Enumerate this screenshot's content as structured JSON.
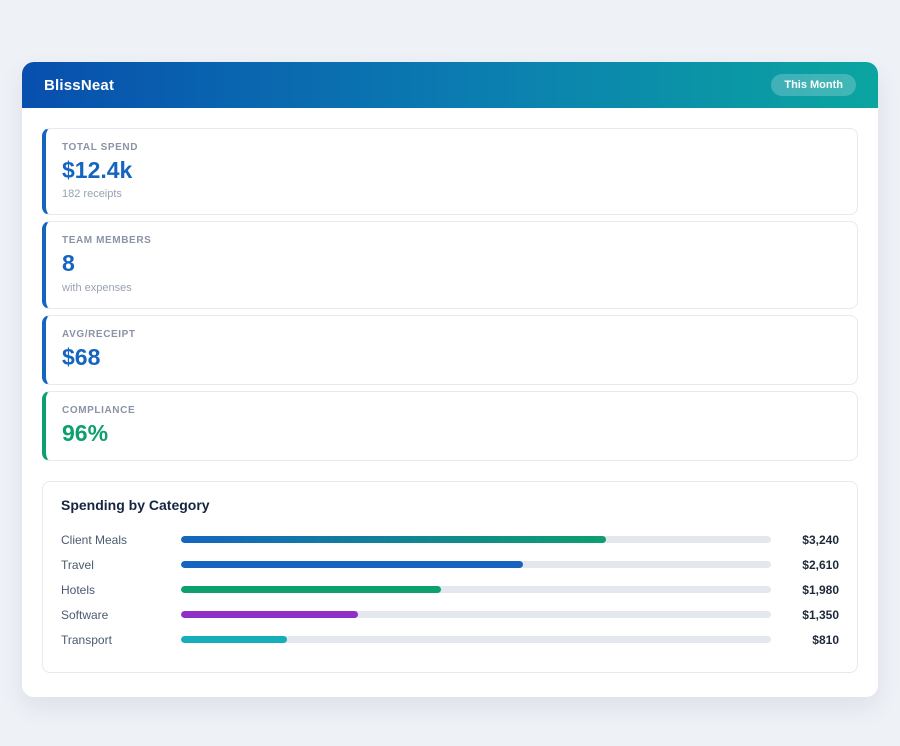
{
  "app": {
    "title": "BlissNeat",
    "period_badge": "This Month"
  },
  "colors": {
    "header_gradient_start": "#084fae",
    "header_gradient_end": "#0ba5a0",
    "primary_blue": "#1565c0",
    "success_green": "#0e9f6e"
  },
  "stats": [
    {
      "label": "TOTAL SPEND",
      "value": "$12.4k",
      "sub": "182 receipts",
      "accent": "#1565c0",
      "value_color": "#1565c0"
    },
    {
      "label": "TEAM MEMBERS",
      "value": "8",
      "sub": "with expenses",
      "accent": "#1565c0",
      "value_color": "#1565c0"
    },
    {
      "label": "AVG/RECEIPT",
      "value": "$68",
      "accent": "#1565c0",
      "value_color": "#1565c0"
    },
    {
      "label": "COMPLIANCE",
      "value": "96%",
      "accent": "#0e9f6e",
      "value_color": "#0e9f6e"
    }
  ],
  "chart_data": {
    "type": "bar",
    "title": "Spending by Category",
    "categories": [
      "Client Meals",
      "Travel",
      "Hotels",
      "Software",
      "Transport"
    ],
    "values": [
      3240,
      2610,
      1980,
      1350,
      810
    ],
    "value_labels": [
      "$3,240",
      "$2,610",
      "$1,980",
      "$1,350",
      "$810"
    ],
    "axis_max": 4500,
    "bar_colors": [
      "linear-gradient(90deg,#1565c0,#0e9f6e)",
      "#1565c0",
      "#0e9f6e",
      "#8e2fc7",
      "#17aebc"
    ],
    "legend_position": "none",
    "grid": false
  }
}
